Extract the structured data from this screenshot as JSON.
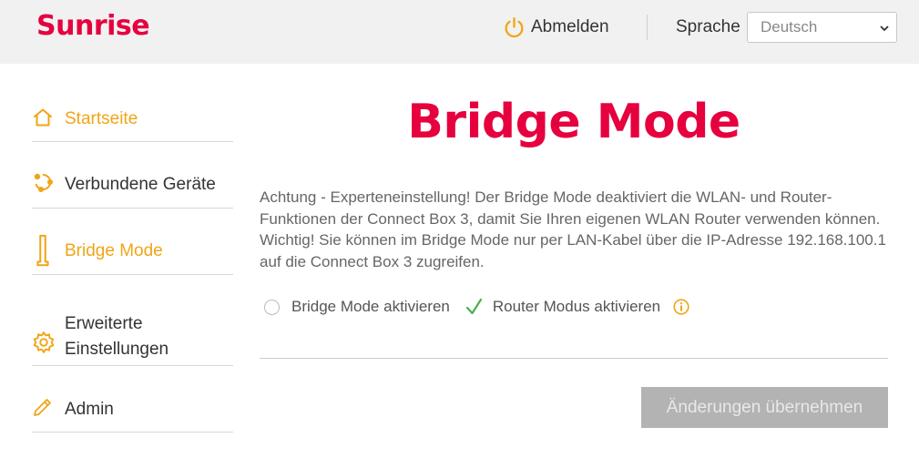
{
  "header": {
    "brand": "Sunrise",
    "logout_label": "Abmelden",
    "language_label": "Sprache",
    "language_selected": "Deutsch"
  },
  "sidebar": {
    "items": [
      {
        "label": "Startseite",
        "icon": "home-icon",
        "active": true
      },
      {
        "label": "Verbundene Geräte",
        "icon": "devices-icon",
        "active": false
      },
      {
        "label": "Bridge Mode",
        "icon": "bridge-icon",
        "active": true
      },
      {
        "label_line1": "Erweiterte",
        "label_line2": "Einstellungen",
        "icon": "gear-icon",
        "active": false
      },
      {
        "label": "Admin",
        "icon": "pencil-icon",
        "active": false
      }
    ]
  },
  "main": {
    "title": "Bridge Mode",
    "description": "Achtung - Experteneinstellung! Der Bridge Mode deaktiviert die WLAN- und Router-Funktionen der Connect Box 3, damit Sie Ihren eigenen WLAN Router verwenden können. Wichtig! Sie können im Bridge Mode nur per LAN-Kabel über die IP-Adresse 192.168.100.1 auf die Connect Box 3 zugreifen.",
    "options": [
      {
        "label": "Bridge Mode aktivieren",
        "selected": false
      },
      {
        "label": "Router Modus aktivieren",
        "selected": true
      }
    ],
    "apply_label": "Änderungen übernehmen"
  },
  "colors": {
    "brand_red": "#e6003e",
    "accent_orange": "#f0a516",
    "check_green": "#4caf50",
    "disabled_button": "#b3b3b3"
  }
}
